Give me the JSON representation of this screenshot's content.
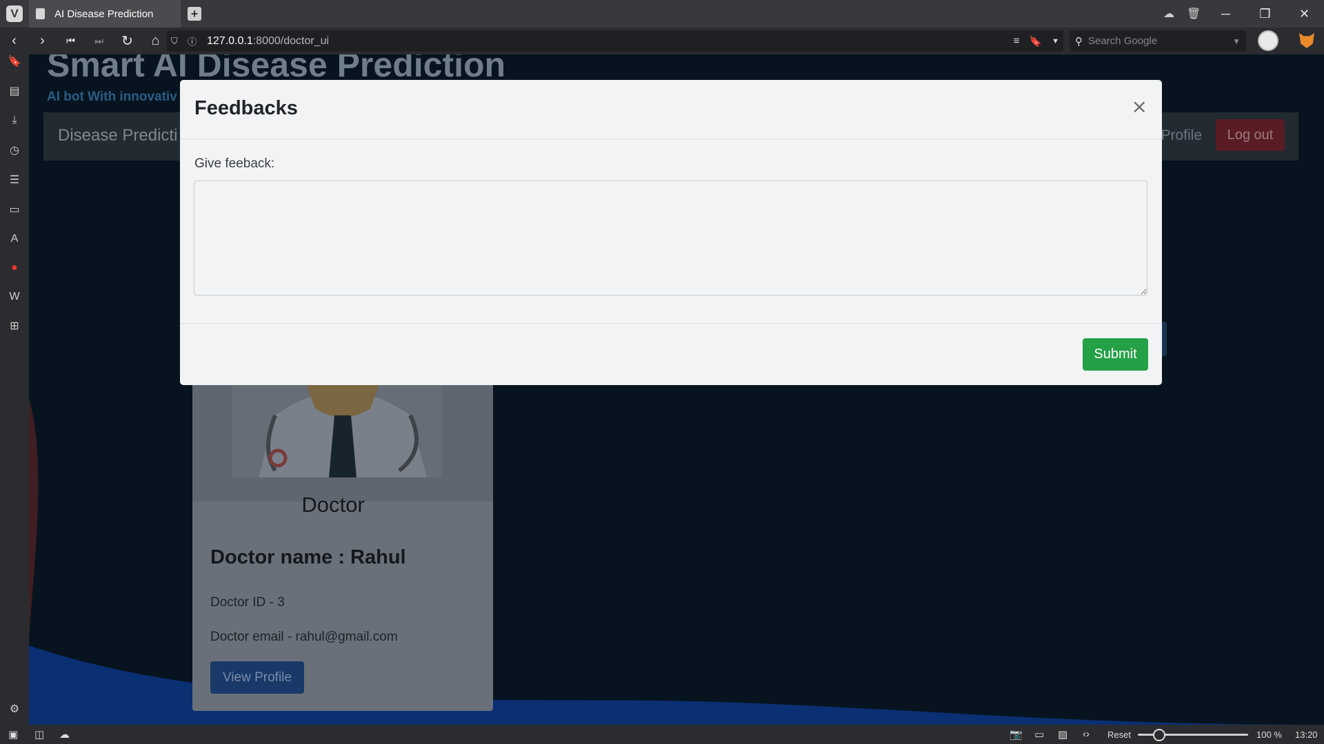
{
  "browser": {
    "tab_title": "AI Disease Prediction",
    "url_host": "127.0.0.1",
    "url_rest": ":8000/doctor_ui",
    "search_placeholder": "Search Google"
  },
  "statusbar": {
    "reset_label": "Reset",
    "zoom_level": "100 %",
    "clock": "13:20"
  },
  "site": {
    "title": "Smart AI Disease Prediction",
    "subtitle": "AI bot With innovativ",
    "brand": "Disease Predicti",
    "nav_profile": "Profile",
    "logout": "Log out"
  },
  "doctor_card": {
    "role": "Doctor",
    "name": "Doctor name : Rahul",
    "id_text": "Doctor ID - 3",
    "email_text": "Doctor email - rahul@gmail.com",
    "view_profile": "View Profile"
  },
  "modal": {
    "title": "Feedbacks",
    "close_glyph": "×",
    "label": "Give feeback:",
    "textarea_value": "",
    "submit": "Submit"
  },
  "colors": {
    "submit_green": "#24a046",
    "page_bg": "#07141f",
    "logout_red": "#5a1c24",
    "profile_blue": "#193a68"
  }
}
